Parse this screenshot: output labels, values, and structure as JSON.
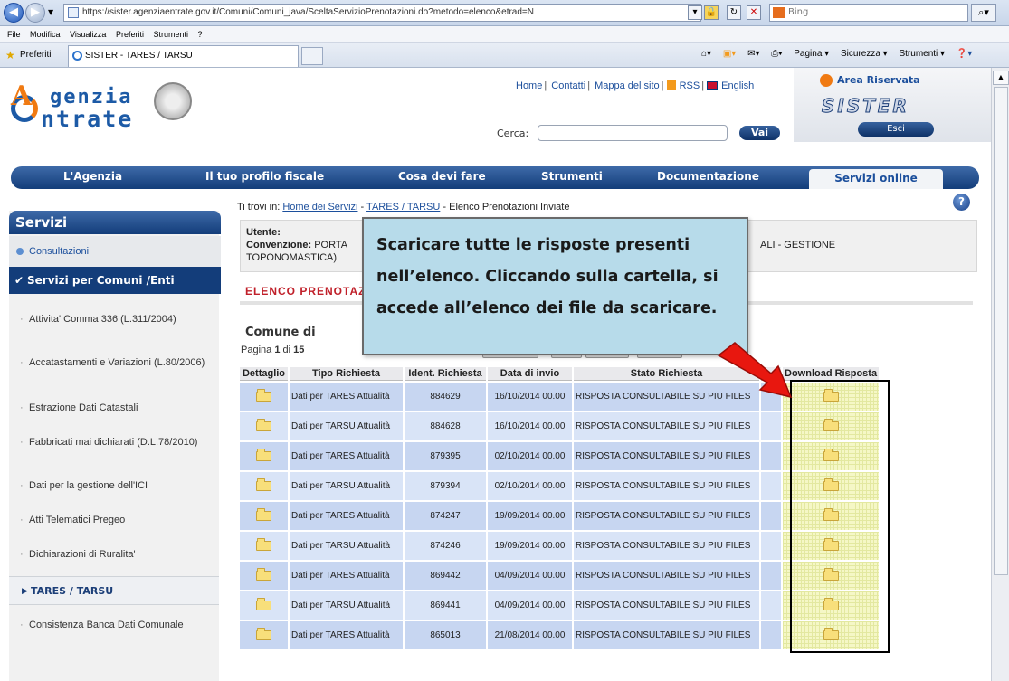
{
  "browser": {
    "url": "https://sister.agenziaentrate.gov.it/Comuni/Comuni_java/SceltaServizioPrenotazioni.do?metodo=elenco&etrad=N",
    "search_placeholder": "Bing",
    "menu": [
      "File",
      "Modifica",
      "Visualizza",
      "Preferiti",
      "Strumenti",
      "?"
    ],
    "favorites_label": "Preferiti",
    "tab_title": "SISTER - TARES / TARSU",
    "commands": [
      "Pagina ▾",
      "Sicurezza ▾",
      "Strumenti ▾"
    ]
  },
  "header": {
    "logo_line1": "genzia",
    "logo_line2": "ntrate",
    "logo_letter_a": "A",
    "links": [
      "Home",
      "Contatti",
      "Mappa del sito",
      "RSS",
      "English"
    ],
    "search_label": "Cerca:",
    "search_button": "Vai",
    "area_riservata": "Area Riservata",
    "sister_logo": "SISTER",
    "logout_button": "Esci"
  },
  "main_nav": [
    "L'Agenzia",
    "Il tuo profilo fiscale",
    "Cosa devi fare",
    "Strumenti",
    "Documentazione",
    "Servizi online"
  ],
  "sidebar": {
    "title": "Servizi",
    "consultazioni": "Consultazioni",
    "servizi_comuni": "Servizi per Comuni /Enti",
    "items": [
      "Attivita' Comma 336 (L.311/2004)",
      "Accatastamenti e Variazioni (L.80/2006)",
      "Estrazione Dati Catastali",
      "Fabbricati mai dichiarati (D.L.78/2010)",
      "Dati per la gestione dell'ICI",
      "Atti Telematici Pregeo",
      "Dichiarazioni di Ruralita'"
    ],
    "tares": "TARES / TARSU",
    "consistenza": "Consistenza Banca Dati Comunale"
  },
  "breadcrumb": {
    "prefix": "Ti trovi in:",
    "home": "Home dei Servizi",
    "tares": "TARES / TARSU",
    "current": "Elenco Prenotazioni Inviate"
  },
  "info": {
    "utente_label": "Utente:",
    "convenzione_label": "Convenzione:",
    "convenzione_start": "PORTA",
    "convenzione_end": "ALI - GESTIONE",
    "toponomastica": "TOPONOMASTICA)"
  },
  "list": {
    "title": "ELENCO PRENOTAZ",
    "comune": "Comune di",
    "pagina_prefix": "Pagina",
    "page": "1",
    "pagina_of": "di",
    "pages": "15"
  },
  "table": {
    "columns": [
      "Dettaglio",
      "Tipo Richiesta",
      "Ident. Richiesta",
      "Data di invio",
      "Stato Richiesta",
      "",
      "Download Risposta"
    ],
    "rows": [
      {
        "tipo": "Dati per TARES Attualità",
        "ident": "884629",
        "data": "16/10/2014 00.00",
        "stato": "RISPOSTA CONSULTABILE SU PIU FILES"
      },
      {
        "tipo": "Dati per TARSU Attualità",
        "ident": "884628",
        "data": "16/10/2014 00.00",
        "stato": "RISPOSTA CONSULTABILE SU PIU FILES"
      },
      {
        "tipo": "Dati per TARES Attualità",
        "ident": "879395",
        "data": "02/10/2014 00.00",
        "stato": "RISPOSTA CONSULTABILE SU PIU FILES"
      },
      {
        "tipo": "Dati per TARSU Attualità",
        "ident": "879394",
        "data": "02/10/2014 00.00",
        "stato": "RISPOSTA CONSULTABILE SU PIU FILES"
      },
      {
        "tipo": "Dati per TARES Attualità",
        "ident": "874247",
        "data": "19/09/2014 00.00",
        "stato": "RISPOSTA CONSULTABILE SU PIU FILES"
      },
      {
        "tipo": "Dati per TARSU Attualità",
        "ident": "874246",
        "data": "19/09/2014 00.00",
        "stato": "RISPOSTA CONSULTABILE SU PIU FILES"
      },
      {
        "tipo": "Dati per TARES Attualità",
        "ident": "869442",
        "data": "04/09/2014 00.00",
        "stato": "RISPOSTA CONSULTABILE SU PIU FILES"
      },
      {
        "tipo": "Dati per TARSU Attualità",
        "ident": "869441",
        "data": "04/09/2014 00.00",
        "stato": "RISPOSTA CONSULTABILE SU PIU FILES"
      },
      {
        "tipo": "Dati per TARES Attualità",
        "ident": "865013",
        "data": "21/08/2014 00.00",
        "stato": "RISPOSTA CONSULTABILE SU PIU FILES"
      }
    ]
  },
  "callout": {
    "text": "Scaricare tutte le risposte presenti nell’elenco. Cliccando sulla cartella, si accede all’elenco dei file da scaricare."
  },
  "colors": {
    "nav_blue": "#133d7a",
    "accent_orange": "#f07a12",
    "title_red": "#c0202a",
    "callout_bg": "#b7dbea",
    "arrow_red": "#e8170f",
    "download_highlight": "#f5f7c6"
  }
}
